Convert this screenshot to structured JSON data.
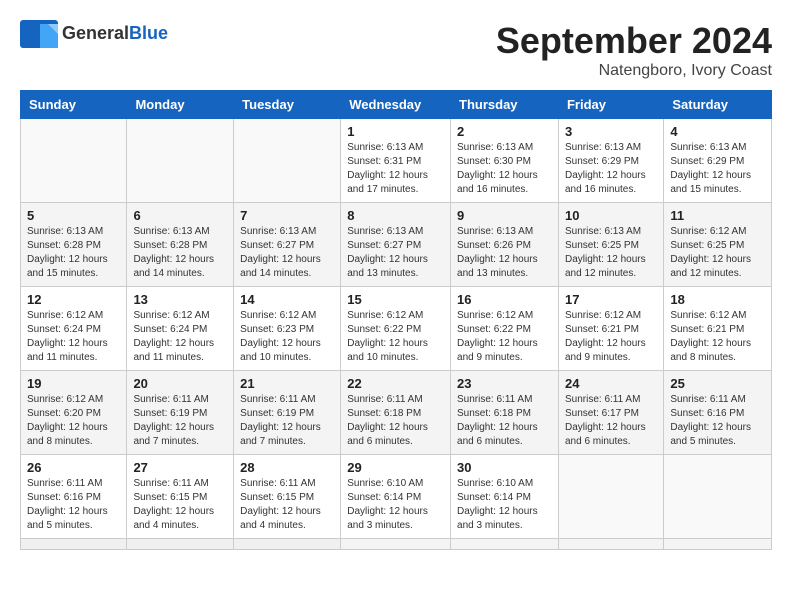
{
  "logo": {
    "general": "General",
    "blue": "Blue"
  },
  "header": {
    "month": "September 2024",
    "location": "Natengboro, Ivory Coast"
  },
  "weekdays": [
    "Sunday",
    "Monday",
    "Tuesday",
    "Wednesday",
    "Thursday",
    "Friday",
    "Saturday"
  ],
  "days": [
    {
      "num": "",
      "info": ""
    },
    {
      "num": "",
      "info": ""
    },
    {
      "num": "",
      "info": ""
    },
    {
      "num": "1",
      "info": "Sunrise: 6:13 AM\nSunset: 6:31 PM\nDaylight: 12 hours\nand 17 minutes."
    },
    {
      "num": "2",
      "info": "Sunrise: 6:13 AM\nSunset: 6:30 PM\nDaylight: 12 hours\nand 16 minutes."
    },
    {
      "num": "3",
      "info": "Sunrise: 6:13 AM\nSunset: 6:29 PM\nDaylight: 12 hours\nand 16 minutes."
    },
    {
      "num": "4",
      "info": "Sunrise: 6:13 AM\nSunset: 6:29 PM\nDaylight: 12 hours\nand 15 minutes."
    },
    {
      "num": "5",
      "info": "Sunrise: 6:13 AM\nSunset: 6:28 PM\nDaylight: 12 hours\nand 15 minutes."
    },
    {
      "num": "6",
      "info": "Sunrise: 6:13 AM\nSunset: 6:28 PM\nDaylight: 12 hours\nand 14 minutes."
    },
    {
      "num": "7",
      "info": "Sunrise: 6:13 AM\nSunset: 6:27 PM\nDaylight: 12 hours\nand 14 minutes."
    },
    {
      "num": "8",
      "info": "Sunrise: 6:13 AM\nSunset: 6:27 PM\nDaylight: 12 hours\nand 13 minutes."
    },
    {
      "num": "9",
      "info": "Sunrise: 6:13 AM\nSunset: 6:26 PM\nDaylight: 12 hours\nand 13 minutes."
    },
    {
      "num": "10",
      "info": "Sunrise: 6:13 AM\nSunset: 6:25 PM\nDaylight: 12 hours\nand 12 minutes."
    },
    {
      "num": "11",
      "info": "Sunrise: 6:12 AM\nSunset: 6:25 PM\nDaylight: 12 hours\nand 12 minutes."
    },
    {
      "num": "12",
      "info": "Sunrise: 6:12 AM\nSunset: 6:24 PM\nDaylight: 12 hours\nand 11 minutes."
    },
    {
      "num": "13",
      "info": "Sunrise: 6:12 AM\nSunset: 6:24 PM\nDaylight: 12 hours\nand 11 minutes."
    },
    {
      "num": "14",
      "info": "Sunrise: 6:12 AM\nSunset: 6:23 PM\nDaylight: 12 hours\nand 10 minutes."
    },
    {
      "num": "15",
      "info": "Sunrise: 6:12 AM\nSunset: 6:22 PM\nDaylight: 12 hours\nand 10 minutes."
    },
    {
      "num": "16",
      "info": "Sunrise: 6:12 AM\nSunset: 6:22 PM\nDaylight: 12 hours\nand 9 minutes."
    },
    {
      "num": "17",
      "info": "Sunrise: 6:12 AM\nSunset: 6:21 PM\nDaylight: 12 hours\nand 9 minutes."
    },
    {
      "num": "18",
      "info": "Sunrise: 6:12 AM\nSunset: 6:21 PM\nDaylight: 12 hours\nand 8 minutes."
    },
    {
      "num": "19",
      "info": "Sunrise: 6:12 AM\nSunset: 6:20 PM\nDaylight: 12 hours\nand 8 minutes."
    },
    {
      "num": "20",
      "info": "Sunrise: 6:11 AM\nSunset: 6:19 PM\nDaylight: 12 hours\nand 7 minutes."
    },
    {
      "num": "21",
      "info": "Sunrise: 6:11 AM\nSunset: 6:19 PM\nDaylight: 12 hours\nand 7 minutes."
    },
    {
      "num": "22",
      "info": "Sunrise: 6:11 AM\nSunset: 6:18 PM\nDaylight: 12 hours\nand 6 minutes."
    },
    {
      "num": "23",
      "info": "Sunrise: 6:11 AM\nSunset: 6:18 PM\nDaylight: 12 hours\nand 6 minutes."
    },
    {
      "num": "24",
      "info": "Sunrise: 6:11 AM\nSunset: 6:17 PM\nDaylight: 12 hours\nand 6 minutes."
    },
    {
      "num": "25",
      "info": "Sunrise: 6:11 AM\nSunset: 6:16 PM\nDaylight: 12 hours\nand 5 minutes."
    },
    {
      "num": "26",
      "info": "Sunrise: 6:11 AM\nSunset: 6:16 PM\nDaylight: 12 hours\nand 5 minutes."
    },
    {
      "num": "27",
      "info": "Sunrise: 6:11 AM\nSunset: 6:15 PM\nDaylight: 12 hours\nand 4 minutes."
    },
    {
      "num": "28",
      "info": "Sunrise: 6:11 AM\nSunset: 6:15 PM\nDaylight: 12 hours\nand 4 minutes."
    },
    {
      "num": "29",
      "info": "Sunrise: 6:10 AM\nSunset: 6:14 PM\nDaylight: 12 hours\nand 3 minutes."
    },
    {
      "num": "30",
      "info": "Sunrise: 6:10 AM\nSunset: 6:14 PM\nDaylight: 12 hours\nand 3 minutes."
    },
    {
      "num": "",
      "info": ""
    },
    {
      "num": "",
      "info": ""
    },
    {
      "num": "",
      "info": ""
    },
    {
      "num": "",
      "info": ""
    },
    {
      "num": "",
      "info": ""
    }
  ]
}
